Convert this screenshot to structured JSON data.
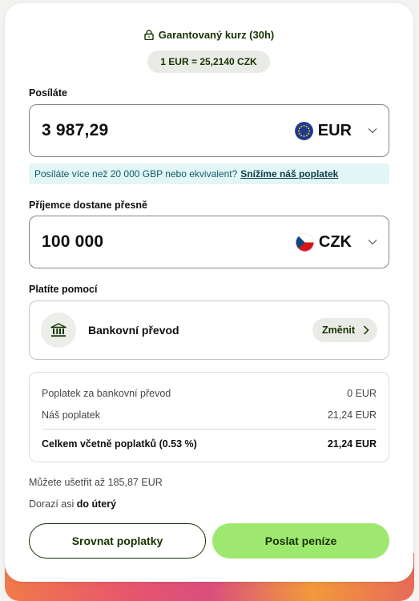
{
  "header": {
    "guarantee_label": "Garantovaný kurz (30h)",
    "rate": "1 EUR = 25,2140 CZK"
  },
  "send": {
    "label": "Posíláte",
    "amount": "3 987,29",
    "currency": "EUR",
    "flag_icon": "eu-flag-icon"
  },
  "notice": {
    "text": "Posíláte více než 20 000 GBP nebo ekvivalent?",
    "link": "Snížíme náš poplatek"
  },
  "receive": {
    "label": "Příjemce dostane přesně",
    "amount": "100 000",
    "currency": "CZK",
    "flag_icon": "czech-flag-icon"
  },
  "payment": {
    "label": "Platíte pomocí",
    "method": "Bankovní převod",
    "change_label": "Změnit"
  },
  "fees": {
    "rows": [
      {
        "label": "Poplatek za bankovní převod",
        "value": "0 EUR"
      },
      {
        "label": "Náš poplatek",
        "value": "21,24 EUR"
      }
    ],
    "total_label": "Celkem včetně poplatků (0.53 %)",
    "total_value": "21,24 EUR"
  },
  "summary": {
    "savings": "Můžete ušetřit až 185,87 EUR",
    "arrival_prefix": "Dorazí asi",
    "arrival_when": "do úterý"
  },
  "actions": {
    "compare_label": "Srovnat poplatky",
    "send_label": "Poslat peníze"
  },
  "colors": {
    "primary_green": "#9fe870",
    "dark_green": "#163300",
    "notice_bg": "#e2f6f5"
  }
}
